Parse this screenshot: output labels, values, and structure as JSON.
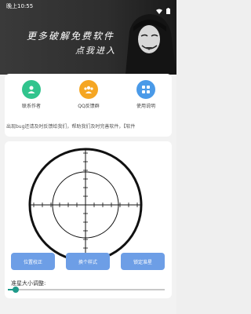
{
  "status_bar": {
    "time": "晚上10:55"
  },
  "banner": {
    "title": "更多破解免费软件",
    "subtitle": "点我进入"
  },
  "actions": [
    {
      "label": "联系作者",
      "icon": "contact-icon",
      "color": "#31c48d"
    },
    {
      "label": "QQ反馈群",
      "icon": "group-icon",
      "color": "#f5a623"
    },
    {
      "label": "使用说明",
      "icon": "help-icon",
      "color": "#4a9ae8"
    }
  ],
  "ticker": {
    "text": "出现bug还请及时反馈给我们，帮助我们及时完善软件，【软件"
  },
  "buttons": {
    "calibrate": "位置校正",
    "change_style": "换个样式",
    "lock": "锁定准星"
  },
  "size_adjust": {
    "label": "准星大小调整:",
    "value": 0.05
  },
  "colors": {
    "button": "#6d9ee6",
    "slider": "#1f9a8a"
  }
}
